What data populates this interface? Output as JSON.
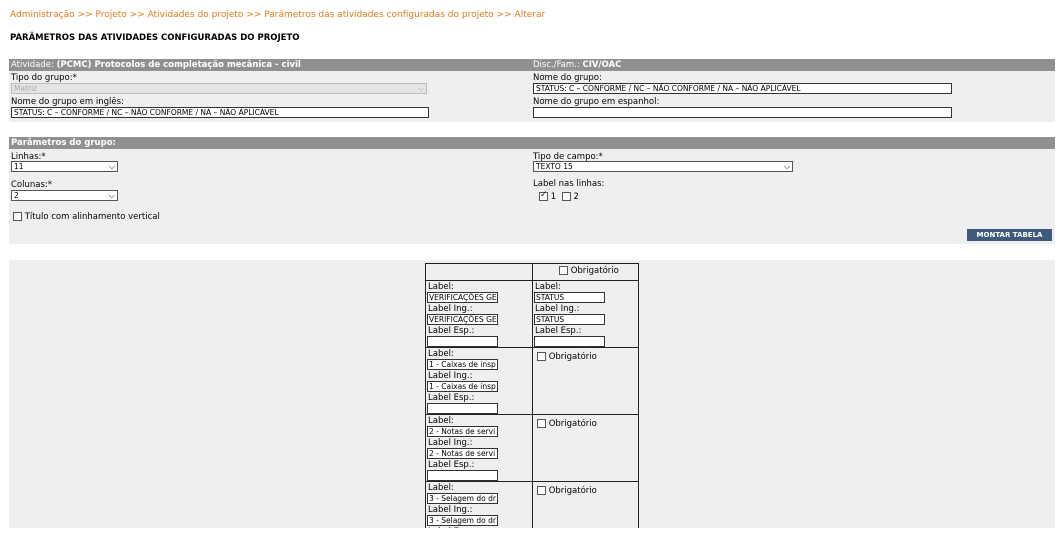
{
  "breadcrumb": [
    "Administração",
    "Projeto",
    "Atividades do projeto",
    "Parâmetros das atividades configuradas do projeto",
    "Alterar"
  ],
  "breadcrumb_sep": ">>",
  "page_title": "PARÂMETROS DAS ATIVIDADES CONFIGURADAS DO PROJETO",
  "activity_panel": {
    "activity_label": "Atividade:",
    "activity_value": "(PCMC) Protocolos de completação mecânica - civil",
    "disc_label": "Disc./Fam.:",
    "disc_value": "CIV/OAC",
    "group_type_label": "Tipo do grupo:*",
    "group_type_value": "Matriz",
    "group_name_label": "Nome do grupo:",
    "group_name_value": "STATUS: C – CONFORME / NC – NÃO CONFORME / NA – NÃO APLICÁVEL",
    "group_name_en_label": "Nome do grupo em inglês:",
    "group_name_en_value": "STATUS: C – CONFORME / NC – NÃO CONFORME / NA – NÃO APLICÁVEL",
    "group_name_es_label": "Nome do grupo em espanhol:",
    "group_name_es_value": ""
  },
  "group_params": {
    "header": "Parâmetros do grupo:",
    "lines_label": "Linhas:*",
    "lines_value": "11",
    "columns_label": "Colunas:*",
    "columns_value": "2",
    "vertical_title_label": "Título com alinhamento vertical",
    "field_type_label": "Tipo de campo:*",
    "field_type_value": "TEXTO 15",
    "label_lines_label": "Label nas linhas:",
    "label_line_1": "1",
    "label_line_2": "2",
    "build_button": "MONTAR TABELA"
  },
  "table": {
    "obligatory_label": "Obrigatório",
    "label_txt": "Label:",
    "label_en_txt": "Label Ing.:",
    "label_es_txt": "Label Esp.:",
    "header_col1": {
      "label": "VERIFICAÇÕES GE",
      "label_en": "VERIFICAÇÕES GE",
      "label_es": ""
    },
    "header_col2": {
      "label": "STATUS",
      "label_en": "STATUS",
      "label_es": ""
    },
    "rows": [
      {
        "label": "1 - Caixas de insp",
        "label_en": "1 - Caixas de insp",
        "label_es": ""
      },
      {
        "label": "2 - Notas de servi",
        "label_en": "2 - Notas de servi",
        "label_es": ""
      },
      {
        "label": "3 - Selagem do dr",
        "label_en": "3 - Selagem do dr",
        "label_es": ""
      }
    ]
  }
}
